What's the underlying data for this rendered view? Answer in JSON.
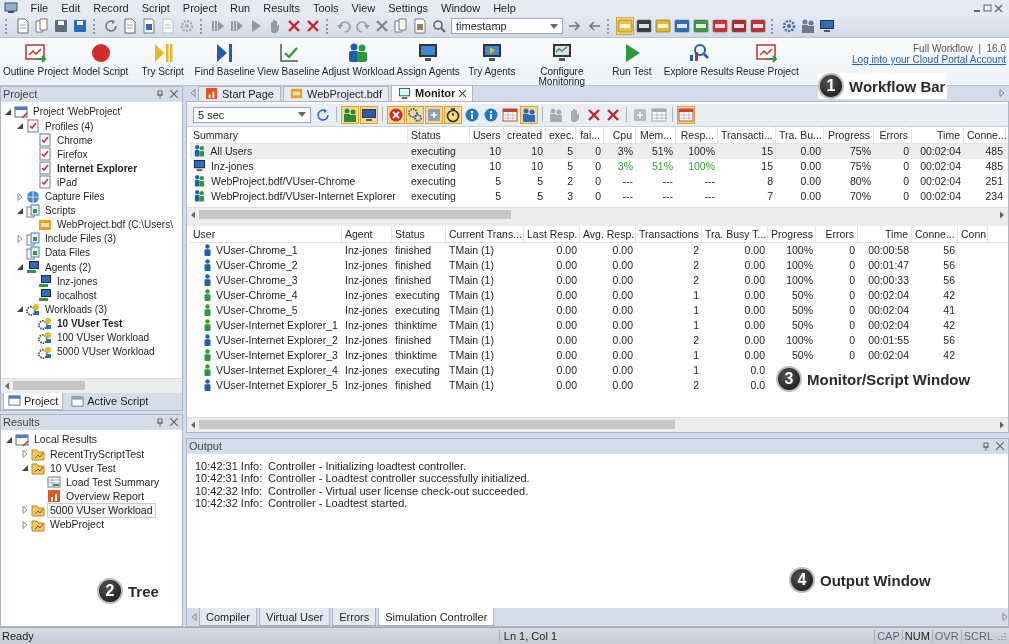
{
  "menu": [
    "File",
    "Edit",
    "Record",
    "Script",
    "Project",
    "Run",
    "Results",
    "Tools",
    "View",
    "Settings",
    "Window",
    "Help"
  ],
  "toolbar": {
    "search_value": "timestamp",
    "toggles": [
      {
        "on": true
      },
      {
        "on": false
      },
      {
        "on": false
      },
      {
        "on": false
      },
      {
        "on": false
      },
      {
        "on": false
      },
      {
        "on": false
      },
      {
        "on": false
      }
    ]
  },
  "workflow": {
    "items": [
      {
        "label": "Outline Project"
      },
      {
        "label": "Model Script"
      },
      {
        "label": "Try Script"
      },
      {
        "label": "Find Baseline"
      },
      {
        "label": "View Baseline"
      },
      {
        "label": "Adjust Workload"
      },
      {
        "label": "Assign Agents"
      },
      {
        "label": "Try Agents"
      },
      {
        "label": "Configure Monitoring"
      },
      {
        "label": "Run Test"
      },
      {
        "label": "Explore Results"
      },
      {
        "label": "Reuse Project"
      }
    ],
    "edition": "Full Workflow  |  16.0",
    "cloud_link": "Log into your Cloud Portal Account"
  },
  "project_panel": {
    "title": "Project",
    "tree": [
      {
        "label": "Project 'WebProject'",
        "kind": "project",
        "expanded": true,
        "default": false,
        "selected": false,
        "children": [
          {
            "label": "Profiles (4)",
            "kind": "profiles",
            "expanded": true,
            "default": false,
            "selected": false,
            "children": [
              {
                "label": "Chrome",
                "kind": "profile",
                "default": false,
                "selected": false
              },
              {
                "label": "Firefox",
                "kind": "profile",
                "default": false,
                "selected": false
              },
              {
                "label": "Internet Explorer",
                "kind": "profile",
                "default": true,
                "selected": false
              },
              {
                "label": "iPad",
                "kind": "profile",
                "default": false,
                "selected": false
              }
            ]
          },
          {
            "label": "Capture Files",
            "kind": "capture",
            "expanded": false,
            "default": false,
            "selected": false
          },
          {
            "label": "Scripts",
            "kind": "scripts",
            "expanded": true,
            "default": false,
            "selected": false,
            "children": [
              {
                "label": "WebProject.bdf (C:\\Users\\",
                "kind": "script",
                "default": false,
                "selected": false
              }
            ]
          },
          {
            "label": "Include Files (3)",
            "kind": "include",
            "expanded": false,
            "default": false,
            "selected": false
          },
          {
            "label": "Data Files",
            "kind": "data",
            "default": false,
            "selected": false
          },
          {
            "label": "Agents (2)",
            "kind": "agents",
            "expanded": true,
            "default": false,
            "selected": false,
            "children": [
              {
                "label": "Inz-jones",
                "kind": "agent",
                "default": false,
                "selected": false
              },
              {
                "label": "localhost",
                "kind": "agent",
                "default": false,
                "selected": false
              }
            ]
          },
          {
            "label": "Workloads (3)",
            "kind": "workloads",
            "expanded": true,
            "default": false,
            "selected": false,
            "children": [
              {
                "label": "10 VUser Test",
                "kind": "workload",
                "default": true,
                "selected": false
              },
              {
                "label": "100 VUser Workload",
                "kind": "workload",
                "default": false,
                "selected": false
              },
              {
                "label": "5000 VUser Workload",
                "kind": "workload",
                "default": false,
                "selected": false
              }
            ]
          }
        ]
      }
    ],
    "tabs": [
      {
        "label": "Project",
        "selected": true
      },
      {
        "label": "Active Script",
        "selected": false
      }
    ]
  },
  "results_panel": {
    "title": "Results",
    "tree": [
      {
        "label": "Local Results",
        "kind": "results",
        "expanded": true,
        "selected": false,
        "children": [
          {
            "label": "RecentTryScriptTest",
            "kind": "result",
            "expanded": false,
            "selected": false
          },
          {
            "label": "10 VUser Test",
            "kind": "result",
            "expanded": true,
            "selected": false,
            "children": [
              {
                "label": "Load Test Summary",
                "kind": "summary",
                "selected": false
              },
              {
                "label": "Overview Report",
                "kind": "report",
                "selected": false
              }
            ]
          },
          {
            "label": "5000 VUser Workload",
            "kind": "result",
            "expanded": false,
            "selected": true
          },
          {
            "label": "WebProject",
            "kind": "result",
            "expanded": false,
            "selected": false
          }
        ]
      }
    ]
  },
  "document_tabs": [
    {
      "label": "Start Page",
      "kind": "start",
      "selected": false
    },
    {
      "label": "WebProject.bdf",
      "kind": "script",
      "selected": false
    },
    {
      "label": "Monitor",
      "kind": "monitor",
      "selected": true
    }
  ],
  "monitor": {
    "interval": "5 sec",
    "toggles": [
      {
        "on": true
      },
      {
        "on": true
      },
      {
        "on": true
      },
      {
        "on": true
      },
      {
        "on": true
      },
      {
        "on": true
      },
      {
        "on": false
      },
      {
        "on": false
      },
      {
        "on": false
      },
      {
        "on": true
      },
      {
        "on": false
      },
      {
        "on": false
      },
      {
        "on": false
      },
      {
        "on": false
      },
      {
        "on": false
      },
      {
        "on": false
      },
      {
        "on": true
      }
    ],
    "summary": {
      "columns": [
        "Summary",
        "Status",
        "Users",
        "created",
        "exec.",
        "fai...",
        "Cpu",
        "Mem...",
        "Resp...",
        "Transacti...",
        "Tra. Bu...",
        "Progress",
        "Errors",
        "Time",
        "Conne..."
      ],
      "rows": [
        {
          "kind": "users",
          "selected": true,
          "healthy": false,
          "cells": [
            "All Users",
            "executing",
            "10",
            "10",
            "5",
            "0",
            "3%",
            "51%",
            "100%",
            "15",
            "0.00",
            "75%",
            "0",
            "00:02:04",
            "485"
          ]
        },
        {
          "kind": "agent",
          "selected": false,
          "healthy": true,
          "cells": [
            "Inz-jones",
            "executing",
            "10",
            "10",
            "5",
            "0",
            "3%",
            "51%",
            "100%",
            "15",
            "0.00",
            "75%",
            "0",
            "00:02:04",
            "485"
          ]
        },
        {
          "kind": "users",
          "selected": false,
          "healthy": false,
          "cells": [
            "WebProject.bdf/VUser-Chrome",
            "executing",
            "5",
            "5",
            "2",
            "0",
            "---",
            "---",
            "---",
            "8",
            "0.00",
            "80%",
            "0",
            "00:02:04",
            "251"
          ]
        },
        {
          "kind": "users",
          "selected": false,
          "healthy": false,
          "cells": [
            "WebProject.bdf/VUser-Internet Explorer",
            "executing",
            "5",
            "5",
            "3",
            "0",
            "---",
            "---",
            "---",
            "7",
            "0.00",
            "70%",
            "0",
            "00:02:04",
            "234"
          ]
        }
      ]
    },
    "users": {
      "columns": [
        "User",
        "Agent",
        "Status",
        "Current Trans...",
        "Last Resp.",
        "Avg. Resp.",
        "Transactions",
        "Tra. Busy T...",
        "Progress",
        "Errors",
        "Time",
        "Conne...",
        "Conn"
      ],
      "rows": [
        {
          "running": false,
          "cells": [
            "VUser-Chrome_1",
            "Inz-jones",
            "finished",
            "TMain (1)",
            "0.00",
            "0.00",
            "2",
            "0.00",
            "100%",
            "0",
            "00:00:58",
            "56"
          ]
        },
        {
          "running": false,
          "cells": [
            "VUser-Chrome_2",
            "Inz-jones",
            "finished",
            "TMain (1)",
            "0.00",
            "0.00",
            "2",
            "0.00",
            "100%",
            "0",
            "00:01:47",
            "56"
          ]
        },
        {
          "running": false,
          "cells": [
            "VUser-Chrome_3",
            "Inz-jones",
            "finished",
            "TMain (1)",
            "0.00",
            "0.00",
            "2",
            "0.00",
            "100%",
            "0",
            "00:00:33",
            "56"
          ]
        },
        {
          "running": true,
          "cells": [
            "VUser-Chrome_4",
            "Inz-jones",
            "executing",
            "TMain (1)",
            "0.00",
            "0.00",
            "1",
            "0.00",
            "50%",
            "0",
            "00:02:04",
            "42"
          ]
        },
        {
          "running": true,
          "cells": [
            "VUser-Chrome_5",
            "Inz-jones",
            "executing",
            "TMain (1)",
            "0.00",
            "0.00",
            "1",
            "0.00",
            "50%",
            "0",
            "00:02:04",
            "41"
          ]
        },
        {
          "running": true,
          "cells": [
            "VUser-Internet Explorer_1",
            "Inz-jones",
            "thinktime",
            "TMain (1)",
            "0.00",
            "0.00",
            "1",
            "0.00",
            "50%",
            "0",
            "00:02:04",
            "42"
          ]
        },
        {
          "running": false,
          "cells": [
            "VUser-Internet Explorer_2",
            "Inz-jones",
            "finished",
            "TMain (1)",
            "0.00",
            "0.00",
            "2",
            "0.00",
            "100%",
            "0",
            "00:01:55",
            "56"
          ]
        },
        {
          "running": true,
          "cells": [
            "VUser-Internet Explorer_3",
            "Inz-jones",
            "thinktime",
            "TMain (1)",
            "0.00",
            "0.00",
            "1",
            "0.00",
            "50%",
            "0",
            "00:02:04",
            "42"
          ]
        },
        {
          "running": true,
          "cells": [
            "VUser-Internet Explorer_4",
            "Inz-jones",
            "executing",
            "TMain (1)",
            "0.00",
            "0.00",
            "1",
            "0.0"
          ]
        },
        {
          "running": false,
          "cells": [
            "VUser-Internet Explorer_5",
            "Inz-jones",
            "finished",
            "TMain (1)",
            "0.00",
            "0.00",
            "2",
            "0.0"
          ]
        }
      ]
    }
  },
  "output": {
    "title": "Output",
    "lines": [
      {
        "time": "10:42:31 Info:",
        "message": "Controller - Initializing loadtest controller."
      },
      {
        "time": "10:42:31 Info:",
        "message": "Controller - Loadtest controller successfully initialized."
      },
      {
        "time": "10:42:32 Info:",
        "message": "Controller - Virtual user license check-out succeeded."
      },
      {
        "time": "10:42:32 Info:",
        "message": "Controller - Loadtest started."
      }
    ],
    "tabs": [
      {
        "label": "Compiler",
        "selected": false
      },
      {
        "label": "Virtual User",
        "selected": false
      },
      {
        "label": "Errors",
        "selected": false
      },
      {
        "label": "Simulation Controller",
        "selected": true
      }
    ]
  },
  "status_bar": {
    "text": "Ready",
    "position": "Ln 1, Col 1",
    "indicators": [
      {
        "label": "CAP",
        "on": false
      },
      {
        "label": "NUM",
        "on": true
      },
      {
        "label": "OVR",
        "on": false
      },
      {
        "label": "SCRL",
        "on": false
      }
    ]
  },
  "annotations": [
    {
      "number": "1",
      "label": "Workflow Bar"
    },
    {
      "number": "2",
      "label": "Tree"
    },
    {
      "number": "3",
      "label": "Monitor/Script Window"
    },
    {
      "number": "4",
      "label": "Output Window"
    }
  ]
}
